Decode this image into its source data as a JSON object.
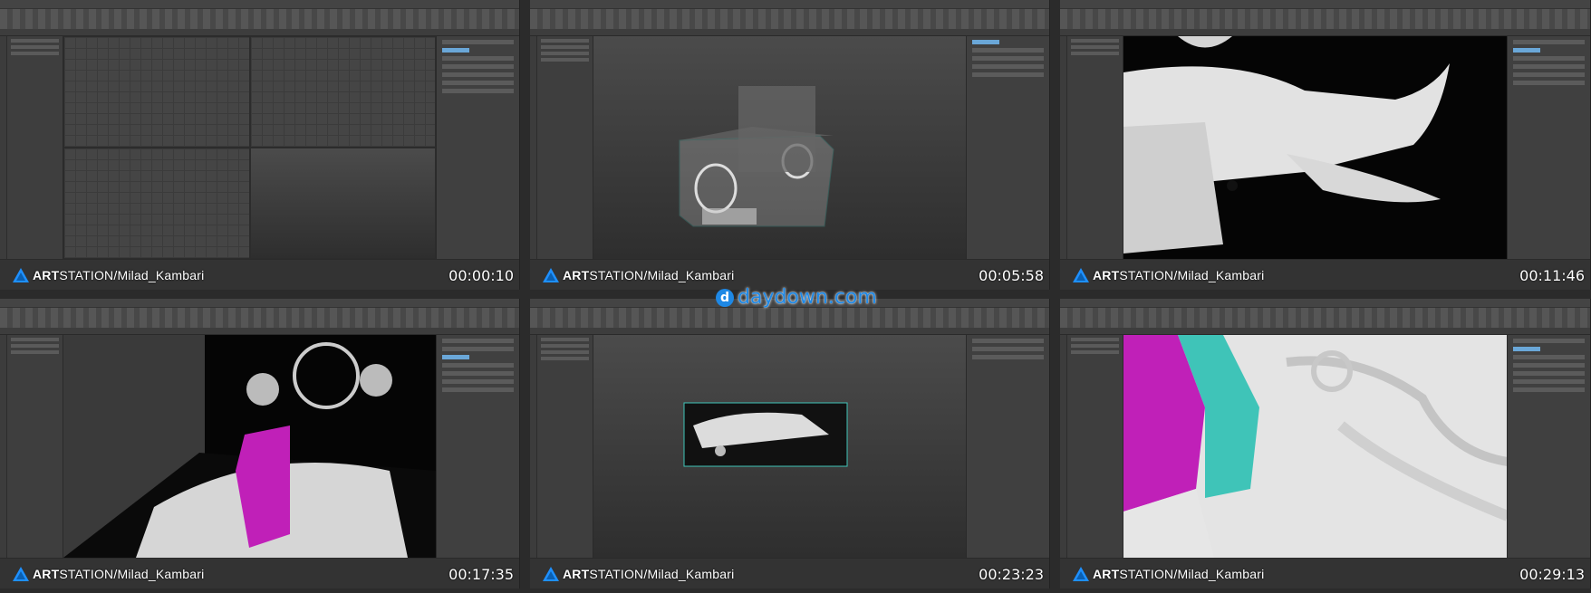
{
  "brand": {
    "name_bold": "ART",
    "name_rest": "STATION/Milad_Kambari"
  },
  "watermark": {
    "icon": "d-icon",
    "text": "daydown.com",
    "color": "#1e88e5"
  },
  "frames": [
    {
      "id": "frame-1",
      "timestamp": "00:00:10",
      "viewport": "quad-grid"
    },
    {
      "id": "frame-2",
      "timestamp": "00:05:58",
      "viewport": "wire-box-model"
    },
    {
      "id": "frame-3",
      "timestamp": "00:11:46",
      "viewport": "ship-close-up"
    },
    {
      "id": "frame-4",
      "timestamp": "00:17:35",
      "viewport": "ship-magenta-part"
    },
    {
      "id": "frame-5",
      "timestamp": "00:23:23",
      "viewport": "ship-in-box"
    },
    {
      "id": "frame-6",
      "timestamp": "00:29:13",
      "viewport": "magenta-cyan-surface"
    }
  ],
  "colors": {
    "accent_cyan": "#3fc4b8",
    "accent_magenta": "#c020b8",
    "ui_bg": "#3a3a3a"
  }
}
